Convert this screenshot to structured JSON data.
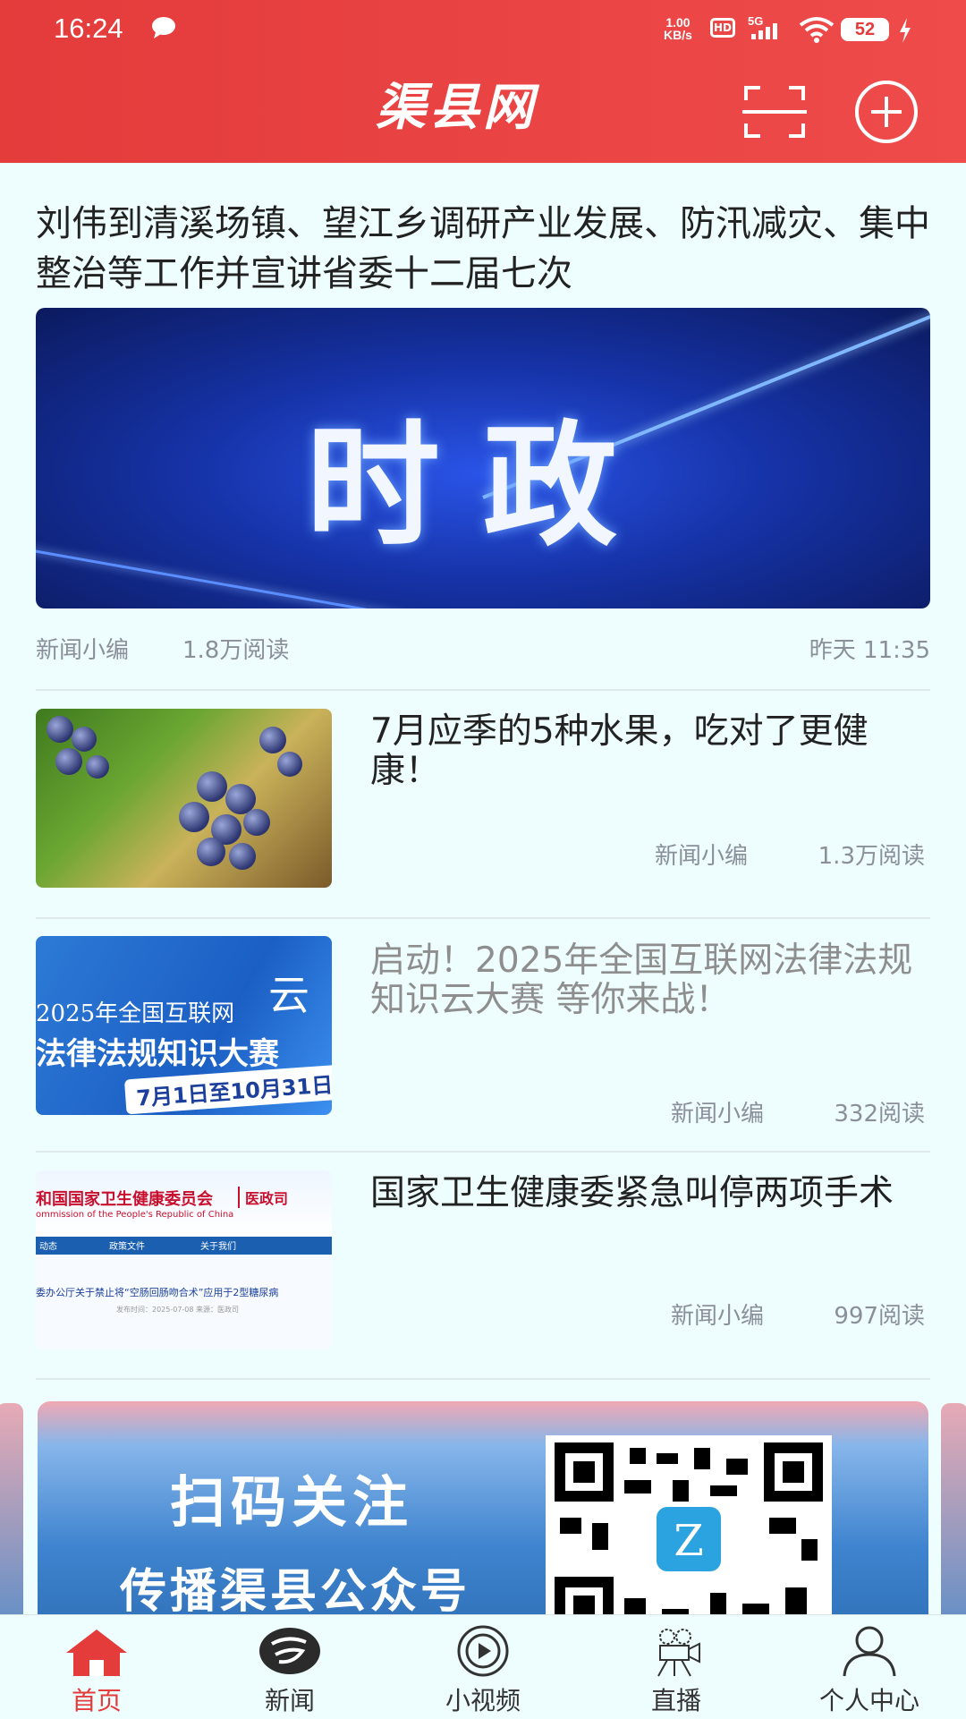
{
  "status_bar": {
    "time": "16:24",
    "net_speed_value": "1.00",
    "net_speed_unit": "KB/s",
    "hd": "HD",
    "network": "5G",
    "battery": "52"
  },
  "header": {
    "logo_text": "渠县网",
    "scan_icon": "scan-icon",
    "add_icon": "plus-icon",
    "color": "#e43b3b"
  },
  "lead_article": {
    "title": "刘伟到清溪场镇、望江乡调研产业发展、防汛减灾、集中整治等工作并宣讲省委十二届七次",
    "image_text": "时政",
    "author": "新闻小编",
    "reads": "1.8万阅读",
    "time": "昨天 11:35"
  },
  "articles": [
    {
      "title": "7月应季的5种水果，吃对了更健康！",
      "author": "新闻小编",
      "reads": "1.3万阅读",
      "read": false
    },
    {
      "title": "启动！2025年全国互联网法律法规知识云大赛 等你来战！",
      "author": "新闻小编",
      "reads": "332阅读",
      "read": true,
      "image_line1": "2025年全国互联网",
      "image_line2": "法律法规知识大赛",
      "image_date": "7月1日至10月31日",
      "image_cloud": "云"
    },
    {
      "title": "国家卫生健康委紧急叫停两项手术",
      "author": "新闻小编",
      "reads": "997阅读",
      "read": false,
      "image_header": "和国国家卫生健康委员会",
      "image_sub": "ommission of the People's Republic of China",
      "image_tag": "医政司",
      "image_nav1": "动态",
      "image_nav2": "政策文件",
      "image_nav3": "关于我们",
      "image_line": "委办公厅关于禁止将“空肠回肠吻合术”应用于2型糖尿病",
      "image_date": "发布时间：2025-07-08  来源：医政司"
    }
  ],
  "banner": {
    "line1": "扫码关注",
    "line2": "传播渠县公众号"
  },
  "tabbar": {
    "items": [
      {
        "label": "首页",
        "icon": "home-icon",
        "active": true
      },
      {
        "label": "新闻",
        "icon": "news-logo-icon",
        "active": false
      },
      {
        "label": "小视频",
        "icon": "play-icon",
        "active": false
      },
      {
        "label": "直播",
        "icon": "camera-icon",
        "active": false
      },
      {
        "label": "个人中心",
        "icon": "user-icon",
        "active": false
      }
    ],
    "active_color": "#e43b3b"
  }
}
